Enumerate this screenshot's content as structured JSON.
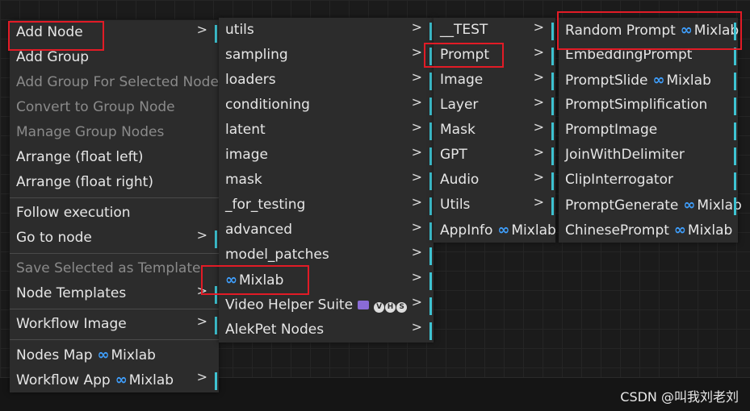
{
  "menu1": {
    "items": [
      {
        "label": "Add Node",
        "disabled": false,
        "arrow": ">",
        "tick": true
      },
      {
        "label": "Add Group",
        "disabled": false
      },
      {
        "label": "Add Group For Selected Nodes",
        "disabled": true
      },
      {
        "label": "Convert to Group Node",
        "disabled": true
      },
      {
        "label": "Manage Group Nodes",
        "disabled": true
      },
      {
        "label": "Arrange (float left)",
        "disabled": false
      },
      {
        "label": "Arrange (float right)",
        "disabled": false
      },
      {
        "sep": true
      },
      {
        "label": "Follow execution",
        "disabled": false
      },
      {
        "label": "Go to node",
        "disabled": false,
        "arrow": ">",
        "tick": true
      },
      {
        "sep": true
      },
      {
        "label": "Save Selected as Template",
        "disabled": true
      },
      {
        "label": "Node Templates",
        "disabled": false,
        "arrow": ">",
        "tick": true
      },
      {
        "sep": true
      },
      {
        "label": "Workflow Image",
        "disabled": false,
        "arrow": ">",
        "tick": true
      },
      {
        "sep": true
      },
      {
        "label": "Nodes Map",
        "disabled": false,
        "suffix": "Mixlab"
      },
      {
        "label": "Workflow App",
        "disabled": false,
        "suffix": "Mixlab",
        "arrow": ">",
        "tick": true
      }
    ]
  },
  "menu2": {
    "items": [
      {
        "label": "utils",
        "arrow": ">",
        "tick": true
      },
      {
        "label": "sampling",
        "arrow": ">",
        "tick": true
      },
      {
        "label": "loaders",
        "arrow": ">",
        "tick": true
      },
      {
        "label": "conditioning",
        "arrow": ">",
        "tick": true
      },
      {
        "label": "latent",
        "arrow": ">",
        "tick": true
      },
      {
        "label": "image",
        "arrow": ">",
        "tick": true
      },
      {
        "label": "mask",
        "arrow": ">",
        "tick": true
      },
      {
        "label": "_for_testing",
        "arrow": ">",
        "tick": true
      },
      {
        "label": "advanced",
        "arrow": ">",
        "tick": true
      },
      {
        "label": "model_patches",
        "arrow": ">",
        "tick": true
      },
      {
        "label": "Mixlab",
        "prefix": "∞",
        "arrow": ">",
        "tick": true
      },
      {
        "label": "Video Helper Suite",
        "vhs": [
          "V",
          "H",
          "S"
        ],
        "arrow": ">",
        "tick": true
      },
      {
        "label": "AlekPet Nodes",
        "arrow": ">",
        "tick": true
      }
    ]
  },
  "menu3": {
    "items": [
      {
        "label": "__TEST",
        "arrow": ">",
        "tick": true
      },
      {
        "label": "Prompt",
        "arrow": ">",
        "tick": true
      },
      {
        "label": "Image",
        "arrow": ">",
        "tick": true
      },
      {
        "label": "Layer",
        "arrow": ">",
        "tick": true
      },
      {
        "label": "Mask",
        "arrow": ">",
        "tick": true
      },
      {
        "label": "GPT",
        "arrow": ">",
        "tick": true
      },
      {
        "label": "Audio",
        "arrow": ">",
        "tick": true
      },
      {
        "label": "Utils",
        "arrow": ">",
        "tick": true
      },
      {
        "label": "AppInfo",
        "suffix": "Mixlab"
      }
    ]
  },
  "menu4": {
    "items": [
      {
        "label": "Random Prompt",
        "suffix": "Mixlab",
        "tick": true
      },
      {
        "label": "EmbeddingPrompt",
        "tick": true
      },
      {
        "label": "PromptSlide",
        "suffix": "Mixlab",
        "tick": true
      },
      {
        "label": "PromptSimplification",
        "tick": true
      },
      {
        "label": "PromptImage",
        "tick": true
      },
      {
        "label": "JoinWithDelimiter",
        "tick": true
      },
      {
        "label": "ClipInterrogator",
        "tick": true
      },
      {
        "label": "PromptGenerate",
        "suffix": "Mixlab",
        "tick": true
      },
      {
        "label": "ChinesePrompt",
        "suffix": "Mixlab",
        "tick": false
      }
    ]
  },
  "watermark": "CSDN @叫我刘老刘",
  "icons": {
    "infinity": "∞"
  }
}
